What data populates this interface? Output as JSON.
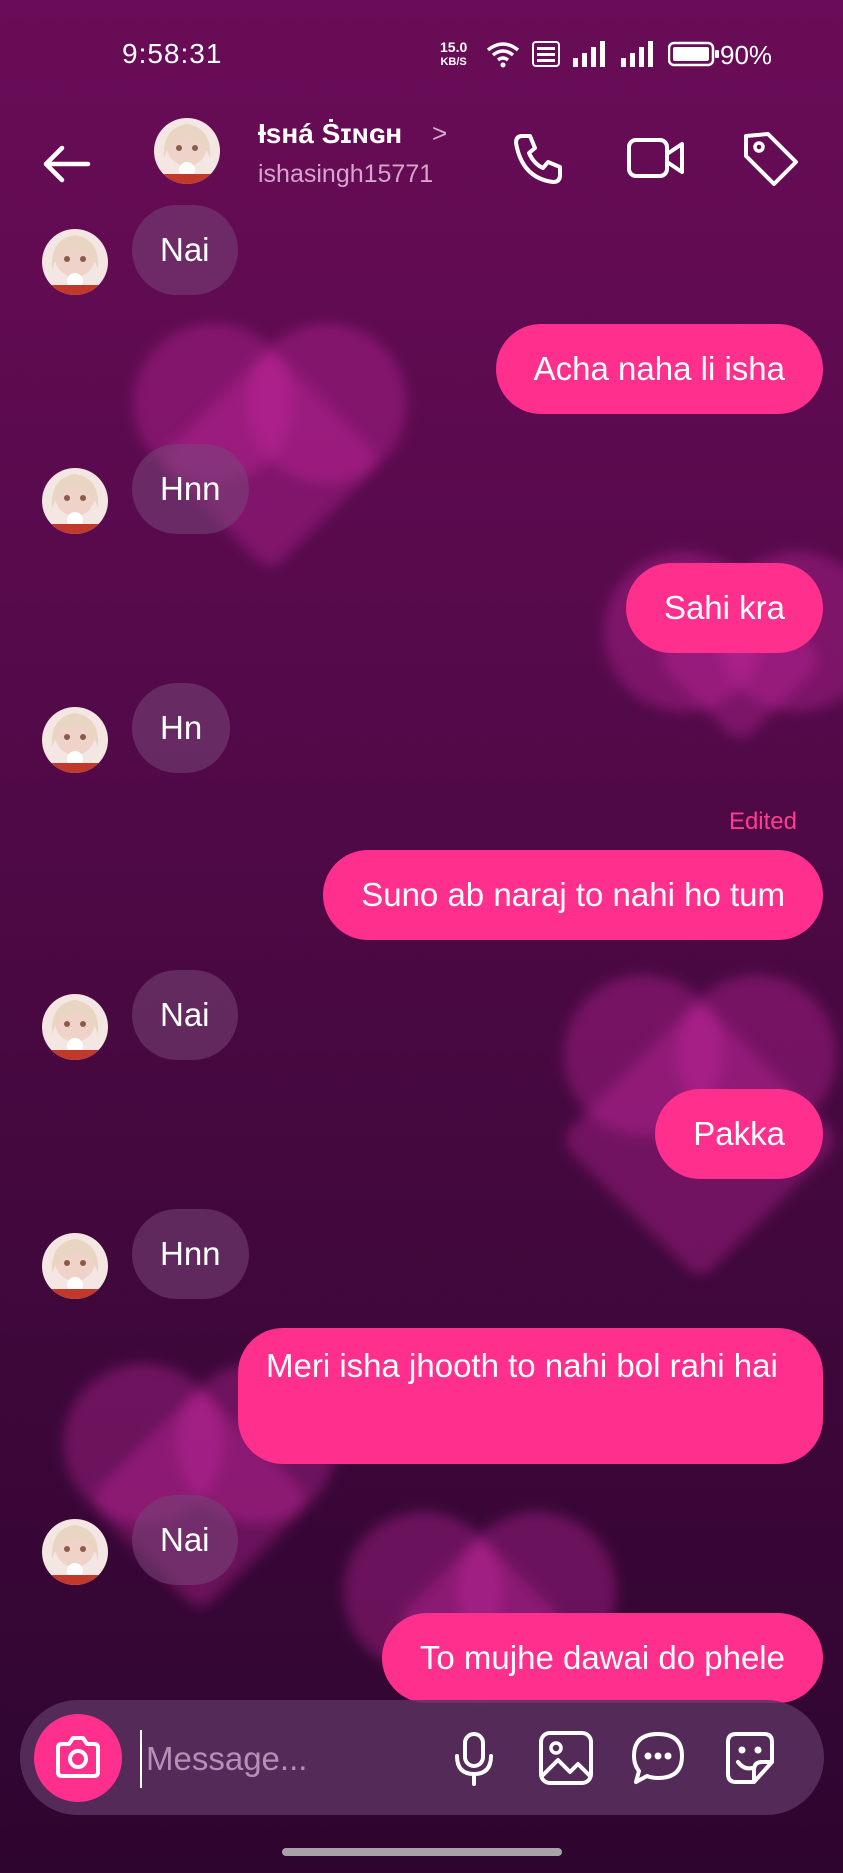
{
  "status_bar": {
    "time": "9:58:31",
    "speed_value": "15.0",
    "speed_unit": "KB/S",
    "battery_pct": "90%"
  },
  "header": {
    "contact_name": "Ɨѕнá Ṡɪɴɢн",
    "username": "ishasingh15771",
    "chevron": ">"
  },
  "messages": [
    {
      "dir": "in",
      "text": "Nai"
    },
    {
      "dir": "out",
      "text": "Acha naha li isha"
    },
    {
      "dir": "in",
      "text": "Hnn"
    },
    {
      "dir": "out",
      "text": "Sahi kra"
    },
    {
      "dir": "in",
      "text": "Hn"
    },
    {
      "dir": "out",
      "text": "Suno ab naraj to nahi ho tum",
      "label": "Edited"
    },
    {
      "dir": "in",
      "text": "Nai"
    },
    {
      "dir": "out",
      "text": "Pakka"
    },
    {
      "dir": "in",
      "text": "Hnn"
    },
    {
      "dir": "out",
      "text": "Meri isha jhooth to nahi bol rahi hai"
    },
    {
      "dir": "in",
      "text": "Nai"
    },
    {
      "dir": "out",
      "text": "To mujhe dawai do phele"
    }
  ],
  "composer": {
    "placeholder": "Message..."
  },
  "icons": {
    "back": "arrow-left-icon",
    "call": "phone-icon",
    "video": "video-camera-icon",
    "tag": "tag-icon",
    "camera": "camera-icon",
    "mic": "microphone-icon",
    "gallery": "image-icon",
    "chat": "chat-bubble-icon",
    "sticker": "sticker-icon"
  },
  "colors": {
    "accent": "#ff2f8e",
    "incoming_bubble": "#6c3f6b",
    "edited_label": "#ff3c8f"
  }
}
